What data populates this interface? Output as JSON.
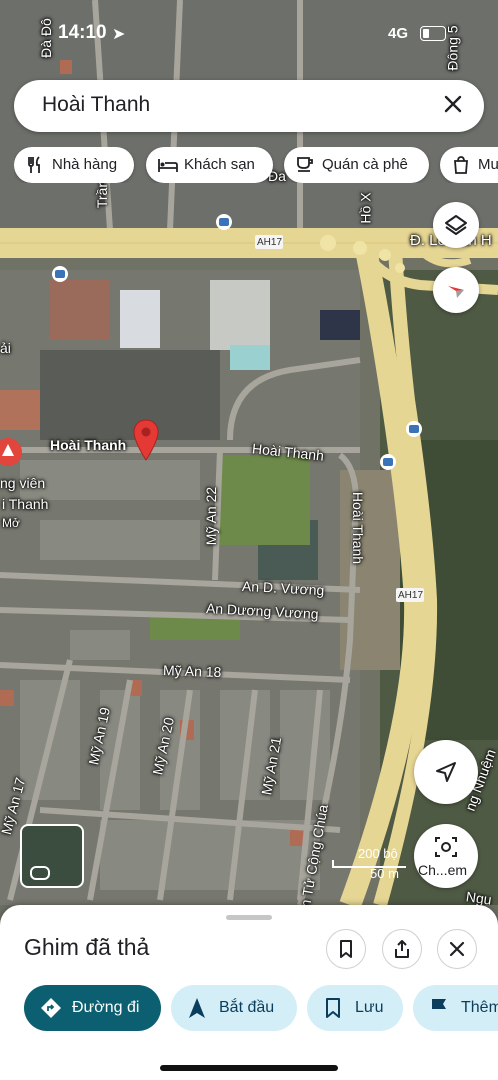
{
  "status_bar": {
    "time": "14:10",
    "network": "4G"
  },
  "search": {
    "query": "Hoài Thanh"
  },
  "categories": [
    {
      "label": "Nhà hàng",
      "icon": "restaurant-icon"
    },
    {
      "label": "Khách sạn",
      "icon": "hotel-icon"
    },
    {
      "label": "Quán cà phê",
      "icon": "coffee-icon"
    },
    {
      "label": "Mu",
      "icon": "shopping-bag-icon"
    }
  ],
  "map_labels": {
    "pin_label": "Hoài Thanh",
    "street_hoai_thanh_1": "Hoài Thanh",
    "street_hoai_thanh_2": "Hoài Thanh",
    "my_an_22": "Mỹ An 22",
    "an_d_vuong": "An D. Vương",
    "an_duong_vuong": "An Dương Vương",
    "my_an_18": "Mỹ An 18",
    "my_an_19": "Mỹ An 19",
    "my_an_20": "Mỹ An 20",
    "my_an_21": "Mỹ An 21",
    "my_an_17": "Mỹ An 17",
    "hoai_thanh_vertical_side": "Hoài Thanh",
    "ton_that": "n Tử Cộng Chúa",
    "ah17_top": "AH17",
    "ah17_mid": "AH17",
    "road_top_right": "Đ. Lê Văn H",
    "road_right_diag": "ng Nhuệm",
    "road_bottom_right": "Ngu",
    "poi_left_1": "ng viên",
    "poi_left_2": "i Thanh",
    "poi_left_3": "Mở",
    "left_edge_1": "Đà Đô",
    "left_edge_2": "ải",
    "top_street_1": "Trần",
    "top_street_2": "Hồ X",
    "top_right_street": "Đông 5",
    "top_street_3": "Đa"
  },
  "scale": {
    "imperial": "200 bộ",
    "metric": "50 m"
  },
  "controls": {
    "layers": "layers-icon",
    "compass": "compass-icon",
    "my_location": "navigation-arrow-icon",
    "explore_label": "Ch...em"
  },
  "sheet": {
    "title": "Ghim đã thả",
    "actions": [
      {
        "label": "Đường đi",
        "icon": "directions-icon"
      },
      {
        "label": "Bắt đầu",
        "icon": "navigation-icon"
      },
      {
        "label": "Lưu",
        "icon": "bookmark-icon"
      },
      {
        "label": "Thêm",
        "icon": "flag-icon"
      }
    ]
  },
  "colors": {
    "primary_action": "#0b5f70",
    "action_chip": "#d3eef6",
    "pin": "#e53935",
    "highway": "#e6d693"
  }
}
